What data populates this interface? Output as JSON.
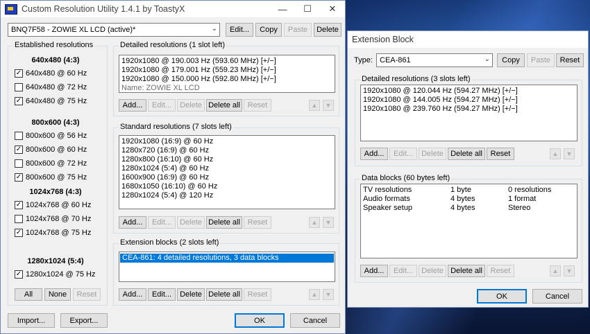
{
  "main": {
    "title": "Custom Resolution Utility 1.4.1 by ToastyX",
    "monitor_select": "BNQ7F58 - ZOWIE XL LCD (active)*",
    "top_buttons": {
      "edit": "Edit...",
      "copy": "Copy",
      "paste": "Paste",
      "delete": "Delete"
    },
    "established": {
      "label": "Established resolutions",
      "groups": [
        {
          "heading": "640x480 (4:3)",
          "items": [
            {
              "label": "640x480 @ 60 Hz",
              "checked": true
            },
            {
              "label": "640x480 @ 72 Hz",
              "checked": false
            },
            {
              "label": "640x480 @ 75 Hz",
              "checked": true
            }
          ]
        },
        {
          "heading": "800x600 (4:3)",
          "items": [
            {
              "label": "800x600 @ 56 Hz",
              "checked": false
            },
            {
              "label": "800x600 @ 60 Hz",
              "checked": true
            },
            {
              "label": "800x600 @ 72 Hz",
              "checked": false
            },
            {
              "label": "800x600 @ 75 Hz",
              "checked": true
            }
          ]
        },
        {
          "heading": "1024x768 (4:3)",
          "items": [
            {
              "label": "1024x768 @ 60 Hz",
              "checked": true
            },
            {
              "label": "1024x768 @ 70 Hz",
              "checked": false
            },
            {
              "label": "1024x768 @ 75 Hz",
              "checked": true
            }
          ]
        },
        {
          "heading": "1280x1024 (5:4)",
          "items": [
            {
              "label": "1280x1024 @ 75 Hz",
              "checked": true
            }
          ]
        }
      ],
      "buttons": {
        "all": "All",
        "none": "None",
        "reset": "Reset"
      }
    },
    "detailed": {
      "label": "Detailed resolutions (1 slot left)",
      "rows": [
        "1920x1080 @ 190.003 Hz (593.60 MHz) [+/−]",
        "1920x1080 @ 179.001 Hz (559.23 MHz) [+/−]",
        "1920x1080 @ 150.000 Hz (592.80 MHz) [+/−]"
      ],
      "name_row": "Name: ZOWIE XL LCD"
    },
    "standard": {
      "label": "Standard resolutions (7 slots left)",
      "rows": [
        "1920x1080 (16:9) @ 60 Hz",
        "1280x720 (16:9) @ 60 Hz",
        "1280x800 (16:10) @ 60 Hz",
        "1280x1024 (5:4) @ 60 Hz",
        "1600x900 (16:9) @ 60 Hz",
        "1680x1050 (16:10) @ 60 Hz",
        "1280x1024 (5:4) @ 120 Hz"
      ]
    },
    "extension": {
      "label": "Extension blocks (2 slots left)",
      "rows": [
        "CEA-861: 4 detailed resolutions, 3 data blocks"
      ]
    },
    "row_buttons": {
      "add": "Add...",
      "edit": "Edit...",
      "delete": "Delete",
      "delete_all": "Delete all",
      "reset": "Reset"
    },
    "bottom": {
      "import": "Import...",
      "export": "Export...",
      "ok": "OK",
      "cancel": "Cancel"
    }
  },
  "ext": {
    "title": "Extension Block",
    "type_label": "Type:",
    "type_value": "CEA-861",
    "buttons": {
      "copy": "Copy",
      "paste": "Paste",
      "reset": "Reset"
    },
    "detailed": {
      "label": "Detailed resolutions (3 slots left)",
      "rows": [
        "1920x1080 @ 120.044 Hz (594.27 MHz) [+/−]",
        "1920x1080 @ 144.005 Hz (594.27 MHz) [+/−]",
        "1920x1080 @ 239.760 Hz (594.27 MHz) [+/−]"
      ]
    },
    "data_blocks": {
      "label": "Data blocks (60 bytes left)",
      "rows": [
        {
          "name": "TV resolutions",
          "size": "1 byte",
          "info": "0 resolutions"
        },
        {
          "name": "Audio formats",
          "size": "4 bytes",
          "info": "1 format"
        },
        {
          "name": "Speaker setup",
          "size": "4 bytes",
          "info": "Stereo"
        }
      ]
    },
    "row_buttons": {
      "add": "Add...",
      "edit": "Edit...",
      "delete": "Delete",
      "delete_all": "Delete all",
      "reset": "Reset"
    },
    "ok": "OK",
    "cancel": "Cancel"
  }
}
